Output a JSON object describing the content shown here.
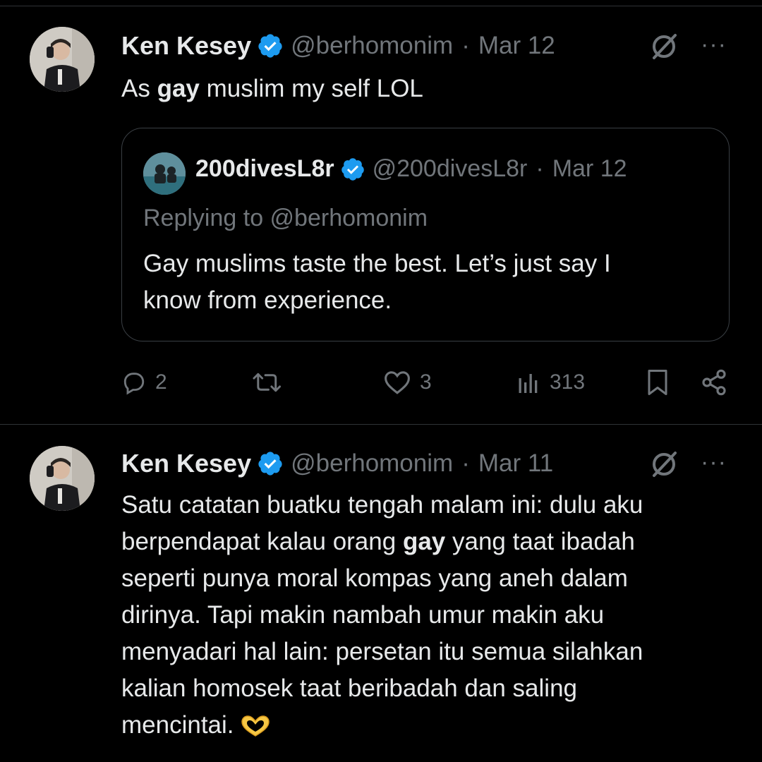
{
  "tweets": [
    {
      "author": {
        "name": "Ken Kesey",
        "handle": "@berhomonim",
        "avatar_icon": "profile-photo"
      },
      "date": "Mar 12",
      "separator": "·",
      "text_parts": {
        "before": "As ",
        "bold": "gay",
        "after": " muslim my self LOL"
      },
      "quote": {
        "author": {
          "name": "200divesL8r",
          "handle": "@200divesL8r",
          "avatar_icon": "diver-photo"
        },
        "date": "Mar 12",
        "replying_to": "Replying to @berhomonim",
        "line1": "Gay muslims taste the best.  Let’s just say I",
        "line2": "know from experience."
      },
      "actions": {
        "replies": "2",
        "retweets": "",
        "likes": "3",
        "views": "313"
      },
      "more_label": "···"
    },
    {
      "author": {
        "name": "Ken Kesey",
        "handle": "@berhomonim",
        "avatar_icon": "profile-photo"
      },
      "date": "Mar 11",
      "separator": "·",
      "lines": {
        "l1": "Satu catatan buatku tengah malam ini: dulu aku",
        "l2_before": "berpendapat kalau orang ",
        "l2_bold": "gay",
        "l2_after": " yang taat ibadah",
        "l3": "seperti punya moral kompas yang aneh dalam",
        "l4": "dirinya. Tapi makin nambah umur makin aku",
        "l5": "menyadari hal lain: persetan itu semua silahkan",
        "l6": "kalian homosek taat beribadah dan saling",
        "l7": "mencintai."
      },
      "emoji": "heart-hands",
      "more_label": "···"
    }
  ],
  "colors": {
    "background": "#000000",
    "text": "#e7e9ea",
    "muted": "#71767b",
    "verified": "#1d9bf0",
    "border": "#2f3336"
  }
}
